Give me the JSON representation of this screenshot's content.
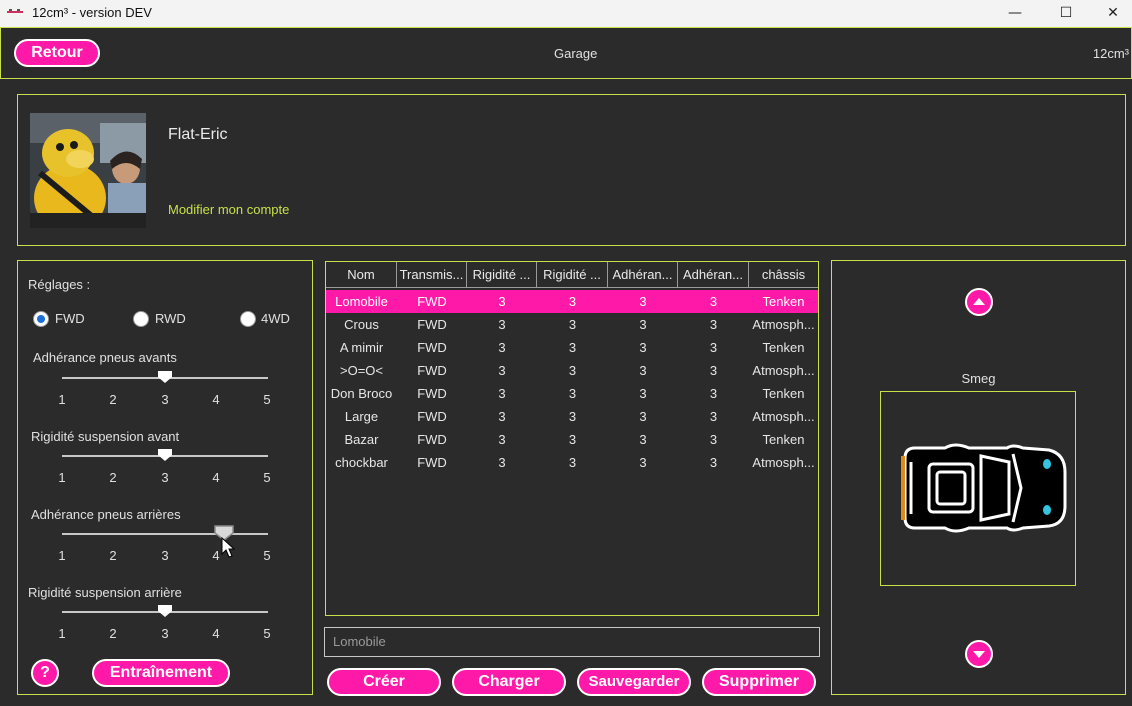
{
  "window": {
    "title": "12cm³ - version DEV",
    "minimize": "—",
    "maximize": "☐",
    "close": "✕"
  },
  "header": {
    "back_label": "Retour",
    "page_title": "Garage",
    "brand": "12cm³"
  },
  "profile": {
    "username": "Flat-Eric",
    "edit_account": "Modifier mon compte"
  },
  "settings": {
    "title": "Réglages :",
    "drive_options": [
      "FWD",
      "RWD",
      "4WD"
    ],
    "selected_drive": "FWD",
    "sliders": [
      {
        "label": "Adhérance pneus avants",
        "value": 3,
        "ticks": [
          "1",
          "2",
          "3",
          "4",
          "5"
        ]
      },
      {
        "label": "Rigidité suspension avant",
        "value": 3,
        "ticks": [
          "1",
          "2",
          "3",
          "4",
          "5"
        ]
      },
      {
        "label": "Adhérance pneus arrières",
        "value": 4,
        "ticks": [
          "1",
          "2",
          "3",
          "4",
          "5"
        ]
      },
      {
        "label": "Rigidité suspension arrière",
        "value": 3,
        "ticks": [
          "1",
          "2",
          "3",
          "4",
          "5"
        ]
      }
    ],
    "help_label": "?",
    "training_label": "Entraînement"
  },
  "table": {
    "columns": [
      "Nom",
      "Transmis...",
      "Rigidité ...",
      "Rigidité ...",
      "Adhéran...",
      "Adhéran...",
      "châssis"
    ],
    "rows": [
      [
        "Lomobile",
        "FWD",
        "3",
        "3",
        "3",
        "3",
        "Tenken"
      ],
      [
        "Crous",
        "FWD",
        "3",
        "3",
        "3",
        "3",
        "Atmosph..."
      ],
      [
        "A mimir",
        "FWD",
        "3",
        "3",
        "3",
        "3",
        "Tenken"
      ],
      [
        ">O=O<",
        "FWD",
        "3",
        "3",
        "3",
        "3",
        "Atmosph..."
      ],
      [
        "Don Broco",
        "FWD",
        "3",
        "3",
        "3",
        "3",
        "Tenken"
      ],
      [
        "Large",
        "FWD",
        "3",
        "3",
        "3",
        "3",
        "Atmosph..."
      ],
      [
        "Bazar",
        "FWD",
        "3",
        "3",
        "3",
        "3",
        "Tenken"
      ],
      [
        "chockbar",
        "FWD",
        "3",
        "3",
        "3",
        "3",
        "Atmosph..."
      ]
    ],
    "selected_row": 0
  },
  "name_field": {
    "value": "Lomobile"
  },
  "actions": {
    "create": "Créer",
    "load": "Charger",
    "save": "Sauvegarder",
    "delete": "Supprimer"
  },
  "preview": {
    "chassis_name": "Smeg",
    "up_icon": "chevron-up-icon",
    "down_icon": "chevron-down-icon"
  },
  "colors": {
    "accent": "#ff19a8",
    "border": "#c8e04a",
    "background": "#2b2b2b"
  }
}
